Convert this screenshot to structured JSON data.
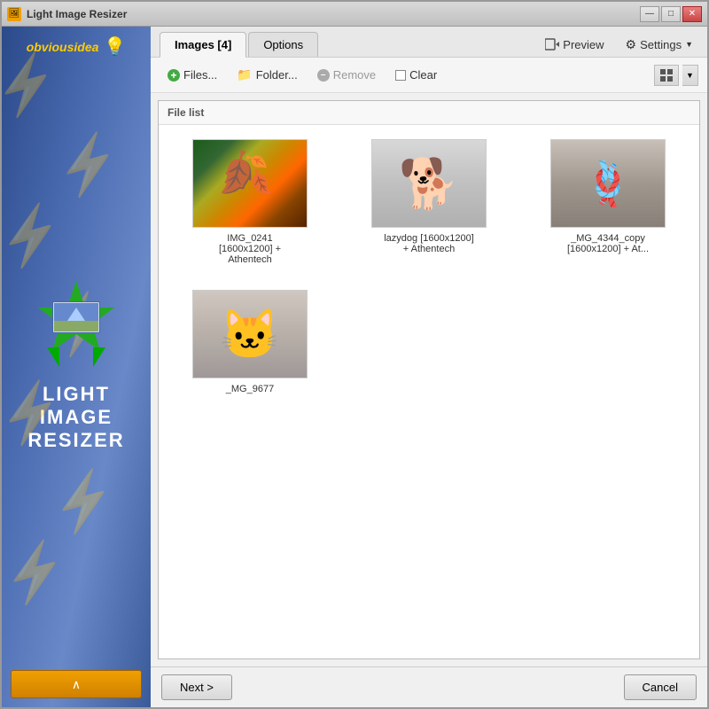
{
  "window": {
    "title": "Light Image Resizer",
    "min_label": "—",
    "max_label": "□",
    "close_label": "✕"
  },
  "sidebar": {
    "brand_text1": "obvious",
    "brand_text2": "idea",
    "title_line1": "LIGHT",
    "title_line2": "IMAGE",
    "title_line3": "RESIZER",
    "arrow_label": "∧"
  },
  "tabs": {
    "images_label": "Images [4]",
    "options_label": "Options",
    "preview_label": "Preview",
    "settings_label": "Settings"
  },
  "toolbar": {
    "files_label": "Files...",
    "folder_label": "Folder...",
    "remove_label": "Remove",
    "clear_label": "Clear"
  },
  "file_panel": {
    "header": "File list",
    "items": [
      {
        "name": "IMG_0241\n[1600x1200] +\nAthentech",
        "type": "flowers",
        "emoji": "🍂"
      },
      {
        "name": "lazydog [1600x1200]\n+ Athentech",
        "type": "dog",
        "emoji": "🐕"
      },
      {
        "name": "_MG_4344_copy\n[1600x1200] + At...",
        "type": "rope",
        "emoji": "🪢"
      },
      {
        "name": "_MG_9677",
        "type": "cat",
        "emoji": "🐱"
      }
    ]
  },
  "bottom": {
    "next_label": "Next >",
    "cancel_label": "Cancel"
  }
}
